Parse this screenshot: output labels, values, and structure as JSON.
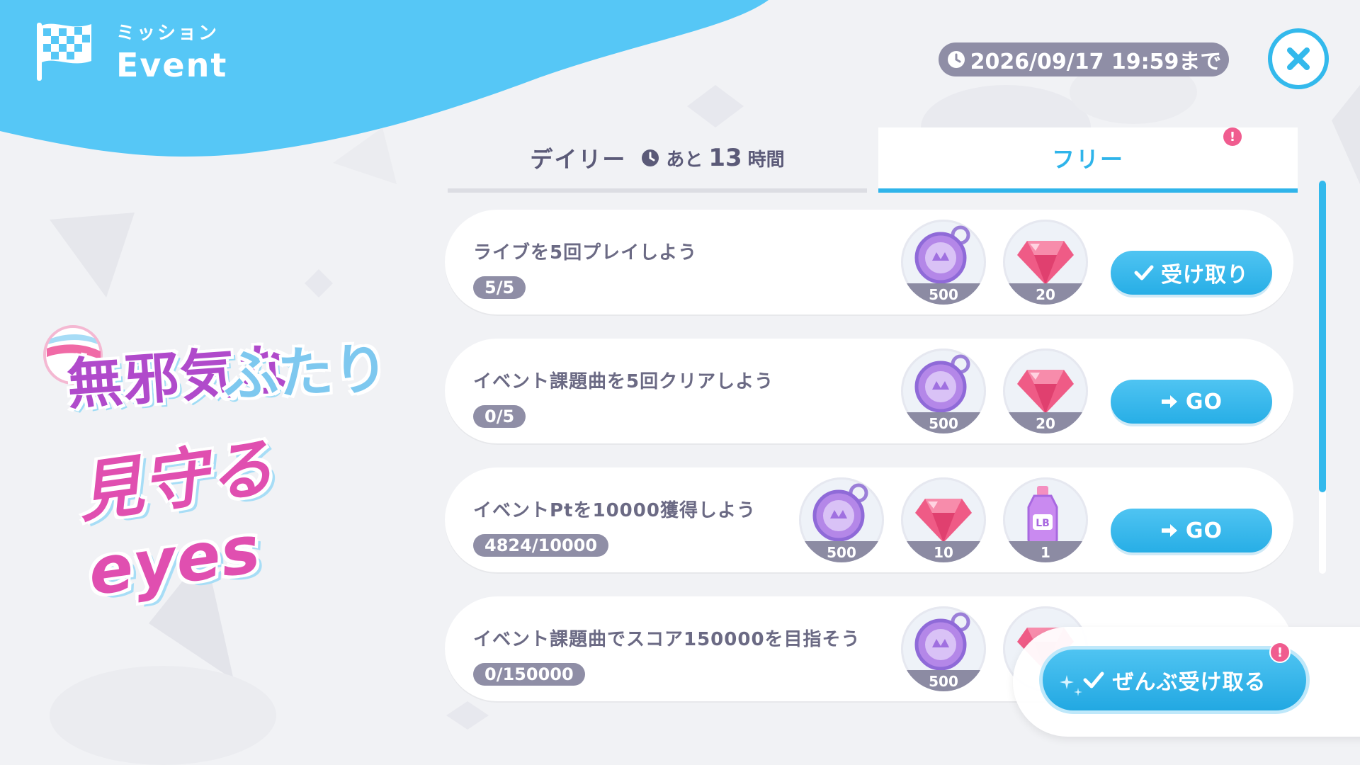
{
  "header": {
    "subtitle": "ミッション",
    "title": "Event",
    "icon": "checkered-flag-icon"
  },
  "deadline": {
    "text": "2026/09/17 19:59まで",
    "icon": "clock-icon"
  },
  "close": {
    "icon": "close-icon"
  },
  "tabs": {
    "daily": {
      "label": "デイリー",
      "timer_prefix": "あと",
      "timer_value": "13",
      "timer_unit": "時間",
      "icon": "clock-icon"
    },
    "free": {
      "label": "フリー",
      "selected": true,
      "alert": "!"
    }
  },
  "logo": {
    "line1": "無邪気な",
    "line2": "ふたり",
    "line3": "見守る eyes"
  },
  "missions": [
    {
      "title": "ライブを5回プレイしよう",
      "progress": "5/5",
      "rewards": [
        {
          "icon": "coin-medal-icon",
          "qty": "500"
        },
        {
          "icon": "gem-icon",
          "qty": "20"
        }
      ],
      "action": {
        "label": "受け取り",
        "icon": "check-icon"
      }
    },
    {
      "title": "イベント課題曲を5回クリアしよう",
      "progress": "0/5",
      "rewards": [
        {
          "icon": "coin-medal-icon",
          "qty": "500"
        },
        {
          "icon": "gem-icon",
          "qty": "20"
        }
      ],
      "action": {
        "label": "GO",
        "icon": "arrow-right-icon"
      }
    },
    {
      "title": "イベントPtを10000獲得しよう",
      "progress": "4824/10000",
      "rewards": [
        {
          "icon": "coin-medal-icon",
          "qty": "500"
        },
        {
          "icon": "gem-icon",
          "qty": "10"
        },
        {
          "icon": "lb-bottle-icon",
          "qty": "1",
          "bottle_label": "LB"
        }
      ],
      "action": {
        "label": "GO",
        "icon": "arrow-right-icon"
      }
    },
    {
      "title": "イベント課題曲でスコア150000を目指そう",
      "progress": "0/150000",
      "rewards": [
        {
          "icon": "coin-medal-icon",
          "qty": "500"
        },
        {
          "icon": "gem-icon"
        }
      ]
    }
  ],
  "claim_all": {
    "label": "ぜんぶ受け取る",
    "icon": "check-icon",
    "alert": "!"
  },
  "colors": {
    "accent": "#2fb4ea",
    "badge": "#f05c8f",
    "chip": "#8f8ea6"
  }
}
